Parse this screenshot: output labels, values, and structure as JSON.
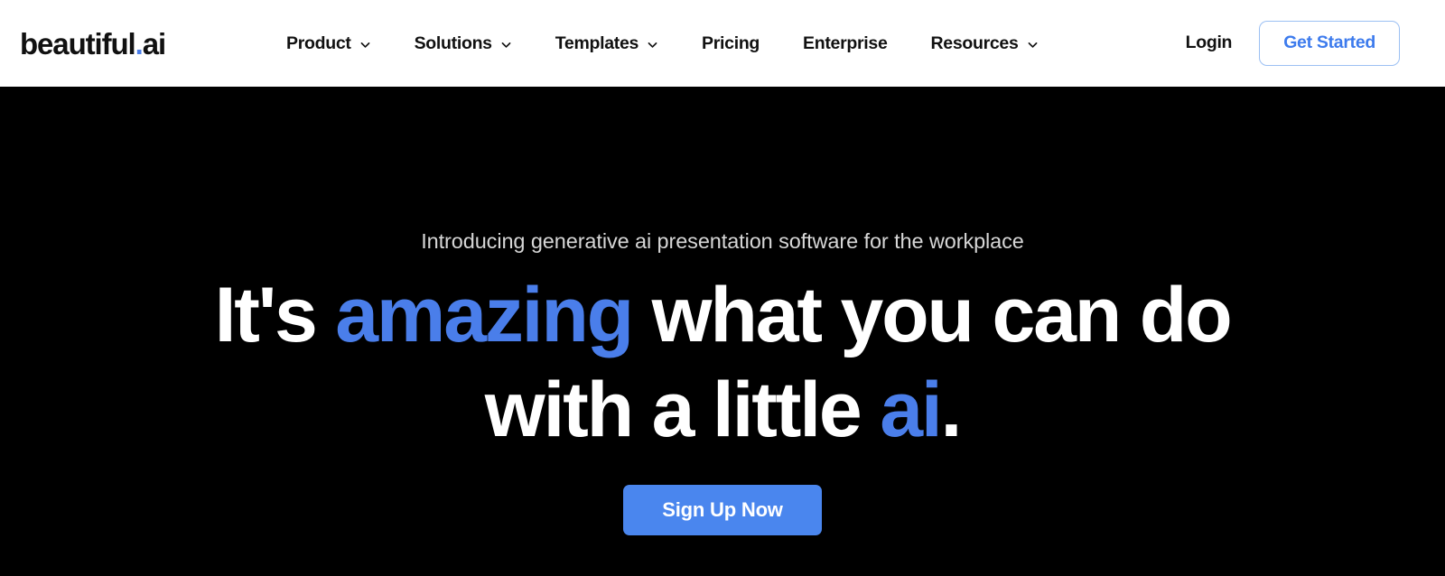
{
  "brand": {
    "logo_name": "beautiful",
    "logo_dot": ".",
    "logo_suffix": "ai",
    "accent_blue": "#4a7eea",
    "cta_blue": "#4a86ee",
    "header_bg": "#ffffff",
    "hero_bg": "#000000"
  },
  "nav": {
    "items": [
      {
        "label": "Product",
        "has_dropdown": true,
        "icon": "chevron-down-icon"
      },
      {
        "label": "Solutions",
        "has_dropdown": true,
        "icon": "chevron-down-icon"
      },
      {
        "label": "Templates",
        "has_dropdown": true,
        "icon": "chevron-down-icon"
      },
      {
        "label": "Pricing",
        "has_dropdown": false,
        "icon": ""
      },
      {
        "label": "Enterprise",
        "has_dropdown": false,
        "icon": ""
      },
      {
        "label": "Resources",
        "has_dropdown": true,
        "icon": "chevron-down-icon"
      }
    ],
    "login_label": "Login",
    "get_started_label": "Get Started"
  },
  "hero": {
    "eyebrow": "Introducing generative ai presentation software for the workplace",
    "headline_part1": "It's ",
    "headline_accent1": "amazing",
    "headline_part2": " what you can do with a little ",
    "headline_accent2": "ai",
    "headline_part3": ".",
    "headline_full": "It's amazing what you can do with a little ai.",
    "cta_label": "Sign Up Now"
  }
}
